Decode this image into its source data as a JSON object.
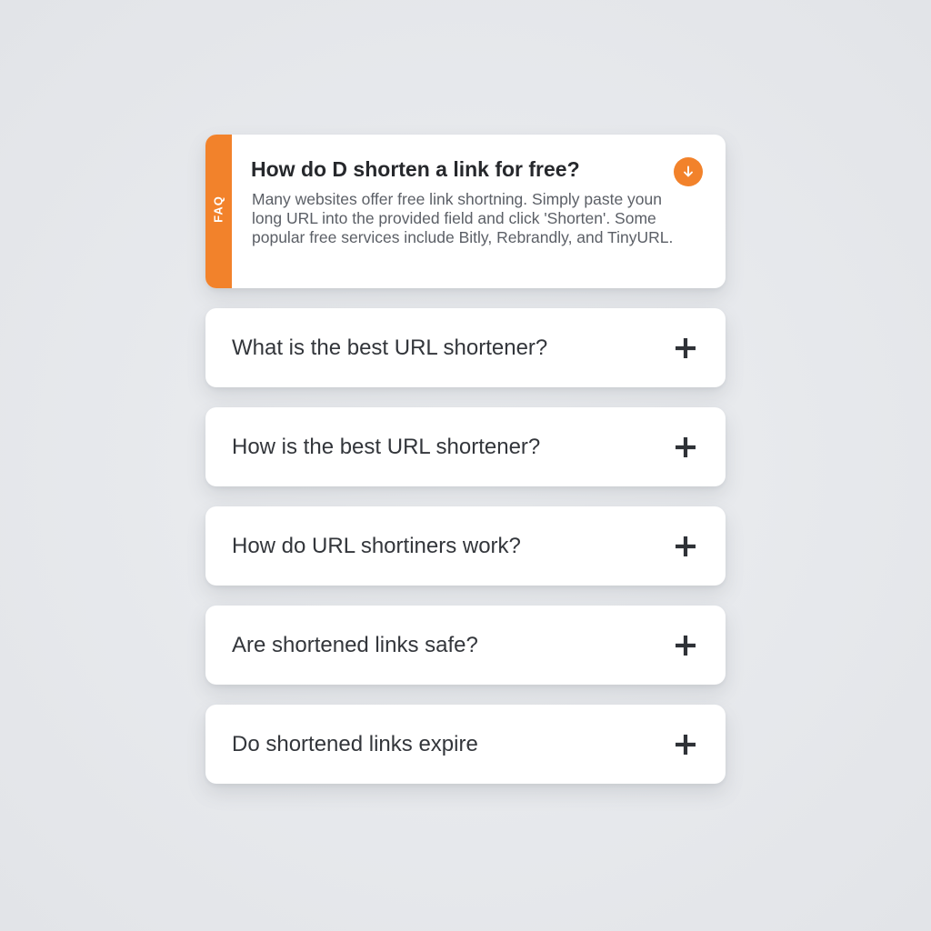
{
  "faq": {
    "badge": "FAQ",
    "accent_color": "#f2822b",
    "expanded": {
      "question": "How do D shorten a link for free?",
      "answer": "Many websites offer free link shortning. Simply paste youn long URL into the provided field and click 'Shorten'. Some popular free services include Bitly, Rebrandly, and TinyURL.",
      "toggle_icon": "arrow-down-circle-icon"
    },
    "collapsed": [
      {
        "question": "What is the best URL shortener?",
        "toggle_icon": "plus-icon"
      },
      {
        "question": "How is the best URL shortener?",
        "toggle_icon": "plus-icon"
      },
      {
        "question": "How do URL shortiners work?",
        "toggle_icon": "plus-icon"
      },
      {
        "question": "Are shortened links safe?",
        "toggle_icon": "plus-icon"
      },
      {
        "question": "Do shortened links expire",
        "toggle_icon": "plus-icon"
      }
    ]
  }
}
